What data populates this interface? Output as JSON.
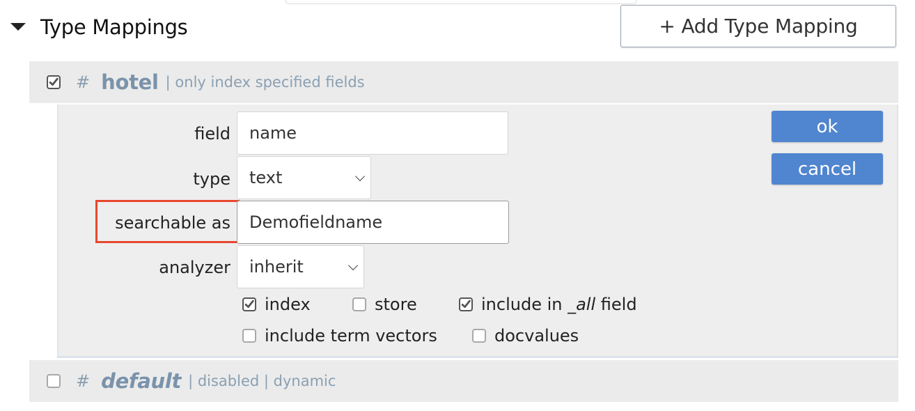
{
  "header": {
    "title": "Type Mappings",
    "collapse_icon": "caret-down-icon",
    "add_button_label": "+ Add Type Mapping"
  },
  "type_mappings": [
    {
      "checked": true,
      "hash": "#",
      "name": "hotel",
      "meta": "| only index specified fields"
    },
    {
      "checked": false,
      "hash": "#",
      "name": "default",
      "meta": "| disabled | dynamic"
    }
  ],
  "field_editor": {
    "field_label": "field",
    "field_value": "name",
    "type_label": "type",
    "type_value": "text",
    "searchable_label": "searchable as",
    "searchable_value": "Demofieldname",
    "analyzer_label": "analyzer",
    "analyzer_value": "inherit",
    "ok_label": "ok",
    "cancel_label": "cancel",
    "options": [
      {
        "label": "index",
        "checked": true
      },
      {
        "label": "store",
        "checked": false
      },
      {
        "label_prefix": "include in ",
        "label_em": "_all",
        "label_suffix": " field",
        "checked": true
      },
      {
        "label": "include term vectors",
        "checked": false
      },
      {
        "label": "docvalues",
        "checked": false
      }
    ],
    "highlight_color": "#e8472e",
    "button_color": "#5085d0"
  }
}
